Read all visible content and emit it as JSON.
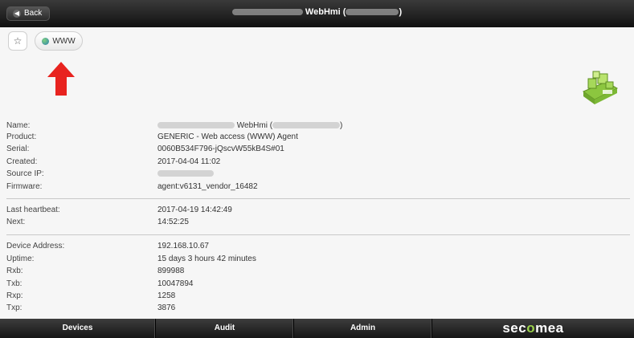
{
  "header": {
    "back_label": "Back",
    "title_main": "WebHmi (",
    "title_close": ")"
  },
  "toolbar": {
    "star_glyph": "☆",
    "www_label": "WWW"
  },
  "details": {
    "name": {
      "label": "Name:",
      "value_main": "WebHmi (",
      "value_close": ")"
    },
    "product": {
      "label": "Product:",
      "value": "GENERIC - Web access (WWW) Agent"
    },
    "serial": {
      "label": "Serial:",
      "value": "0060B534F796-jQscvW55kB4S#01"
    },
    "created": {
      "label": "Created:",
      "value": "2017-04-04 11:02"
    },
    "source_ip": {
      "label": "Source IP:"
    },
    "firmware": {
      "label": "Firmware:",
      "value": "agent:v6131_vendor_16482"
    },
    "last_heartbeat": {
      "label": "Last heartbeat:",
      "value": "2017-04-19 14:42:49"
    },
    "next": {
      "label": "Next:",
      "value": "14:52:25"
    },
    "device_address": {
      "label": "Device Address:",
      "value": "192.168.10.67"
    },
    "uptime": {
      "label": "Uptime:",
      "value": "15 days 3 hours 42 minutes"
    },
    "rxb": {
      "label": "Rxb:",
      "value": "899988"
    },
    "txb": {
      "label": "Txb:",
      "value": "10047894"
    },
    "rxp": {
      "label": "Rxp:",
      "value": "1258"
    },
    "txp": {
      "label": "Txp:",
      "value": "3876"
    }
  },
  "bottom_nav": {
    "devices": "Devices",
    "audit": "Audit",
    "admin": "Admin",
    "brand_pre": "sec",
    "brand_o": "o",
    "brand_post": "mea"
  },
  "colors": {
    "arrow": "#e8231f",
    "brand_accent": "#9ad14b",
    "logo_green": "#8cc63f"
  }
}
